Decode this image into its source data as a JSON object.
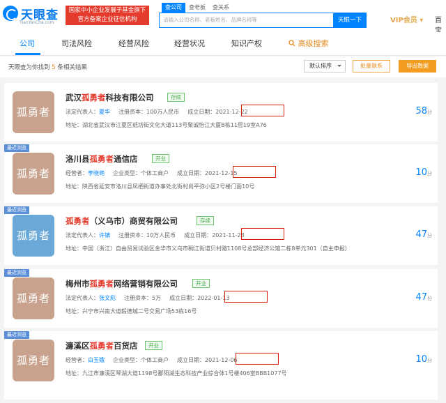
{
  "header": {
    "logo_name": "天眼查",
    "logo_en": "TianYanCha.com",
    "gov_line1": "国家中小企业发展子基金旗下",
    "gov_line2": "官方备案企业征信机构",
    "search_tabs": [
      "查公司",
      "查老板",
      "查关系"
    ],
    "search_placeholder": "请输入公司名称、老板姓名、品牌名称等",
    "search_button": "天眼一下",
    "vip": "VIP会员 ▾",
    "user": "百宝"
  },
  "nav": {
    "items": [
      "公司",
      "司法风险",
      "经营风险",
      "经营状况",
      "知识产权"
    ],
    "advanced": "高级搜索"
  },
  "result": {
    "prefix": "天眼查为你找到 ",
    "count": "5",
    "suffix": " 条相关结果",
    "sort": "默认排序",
    "contact": "批量联系",
    "export": "导出数据"
  },
  "recent_label": "最近浏览",
  "cards": [
    {
      "recent": false,
      "avatar": "孤勇者",
      "avatar_color": "#c9a28d",
      "name_pre": "武汉",
      "name_hl": "孤勇者",
      "name_post": "科技有限公司",
      "status": "存续",
      "l1a_label": "法定代表人：",
      "l1a_value": "夏华",
      "l1b": "注册资本：100万人民币",
      "l1c_label": "成立日期：",
      "date": "2021-12-22",
      "address": "地址：湖北省武汉市江夏区纸坊街文化大道113号聚诚怡江大厦B栋11层19室A76",
      "score": "58",
      "score_unit": "分"
    },
    {
      "recent": true,
      "avatar": "孤勇者",
      "avatar_color": "#c9a28d",
      "name_pre": "洛川县",
      "name_hl": "孤勇者",
      "name_post": "通信店",
      "status": "开业",
      "l1a_label": "经营者：",
      "l1a_value": "李晓艳",
      "l1b": "企业类型：个体工商户",
      "l1c_label": "成立日期：",
      "date": "2021-12-15",
      "address": "地址：陕西省延安市洛川县凤栖街道办事处北街村尚平弥小区2号楼门面10号",
      "score": "10",
      "score_unit": "分"
    },
    {
      "recent": true,
      "avatar": "孤勇者",
      "avatar_color": "#6aa8d8",
      "name_pre": "",
      "name_hl": "孤勇者",
      "name_post": "（义乌市）商贸有限公司",
      "status": "存续",
      "l1a_label": "法定代表人：",
      "l1a_value": "许镇",
      "l1b": "注册资本：10万人民币",
      "l1c_label": "成立日期：",
      "date": "2021-11-23",
      "address": "地址：中国（浙江）自由贸易试验区金华市义乌市稠江街道贝村路1108号总部经济公馆二栋8单元301（自主申报）",
      "score": "47",
      "score_unit": "分"
    },
    {
      "recent": true,
      "avatar": "孤勇者",
      "avatar_color": "#c9a28d",
      "name_pre": "梅州市",
      "name_hl": "孤勇者",
      "name_post": "网络营销有限公司",
      "status": "开业",
      "l1a_label": "法定代表人：",
      "l1a_value": "张文彪",
      "l1b": "注册资本：5万",
      "l1c_label": "成立日期：",
      "date": "2022-01-13",
      "address": "地址：兴宁市兴南大道毅德城二号交易广场53栋16号",
      "score": "47",
      "score_unit": "分"
    },
    {
      "recent": true,
      "avatar": "孤勇者",
      "avatar_color": "#c9a28d",
      "name_pre": "濂溪区",
      "name_hl": "孤勇者",
      "name_post": "百货店",
      "status": "开业",
      "l1a_label": "经营者：",
      "l1a_value": "白玉娥",
      "l1b": "企业类型：个体工商户",
      "l1c_label": "成立日期：",
      "date": "2021-12-06",
      "address": "地址：九江市濂溪区琴湖大道1198号鄱阳湖生态科技产业综合体1号楼406室BBB1077号",
      "score": "10",
      "score_unit": "分"
    }
  ]
}
